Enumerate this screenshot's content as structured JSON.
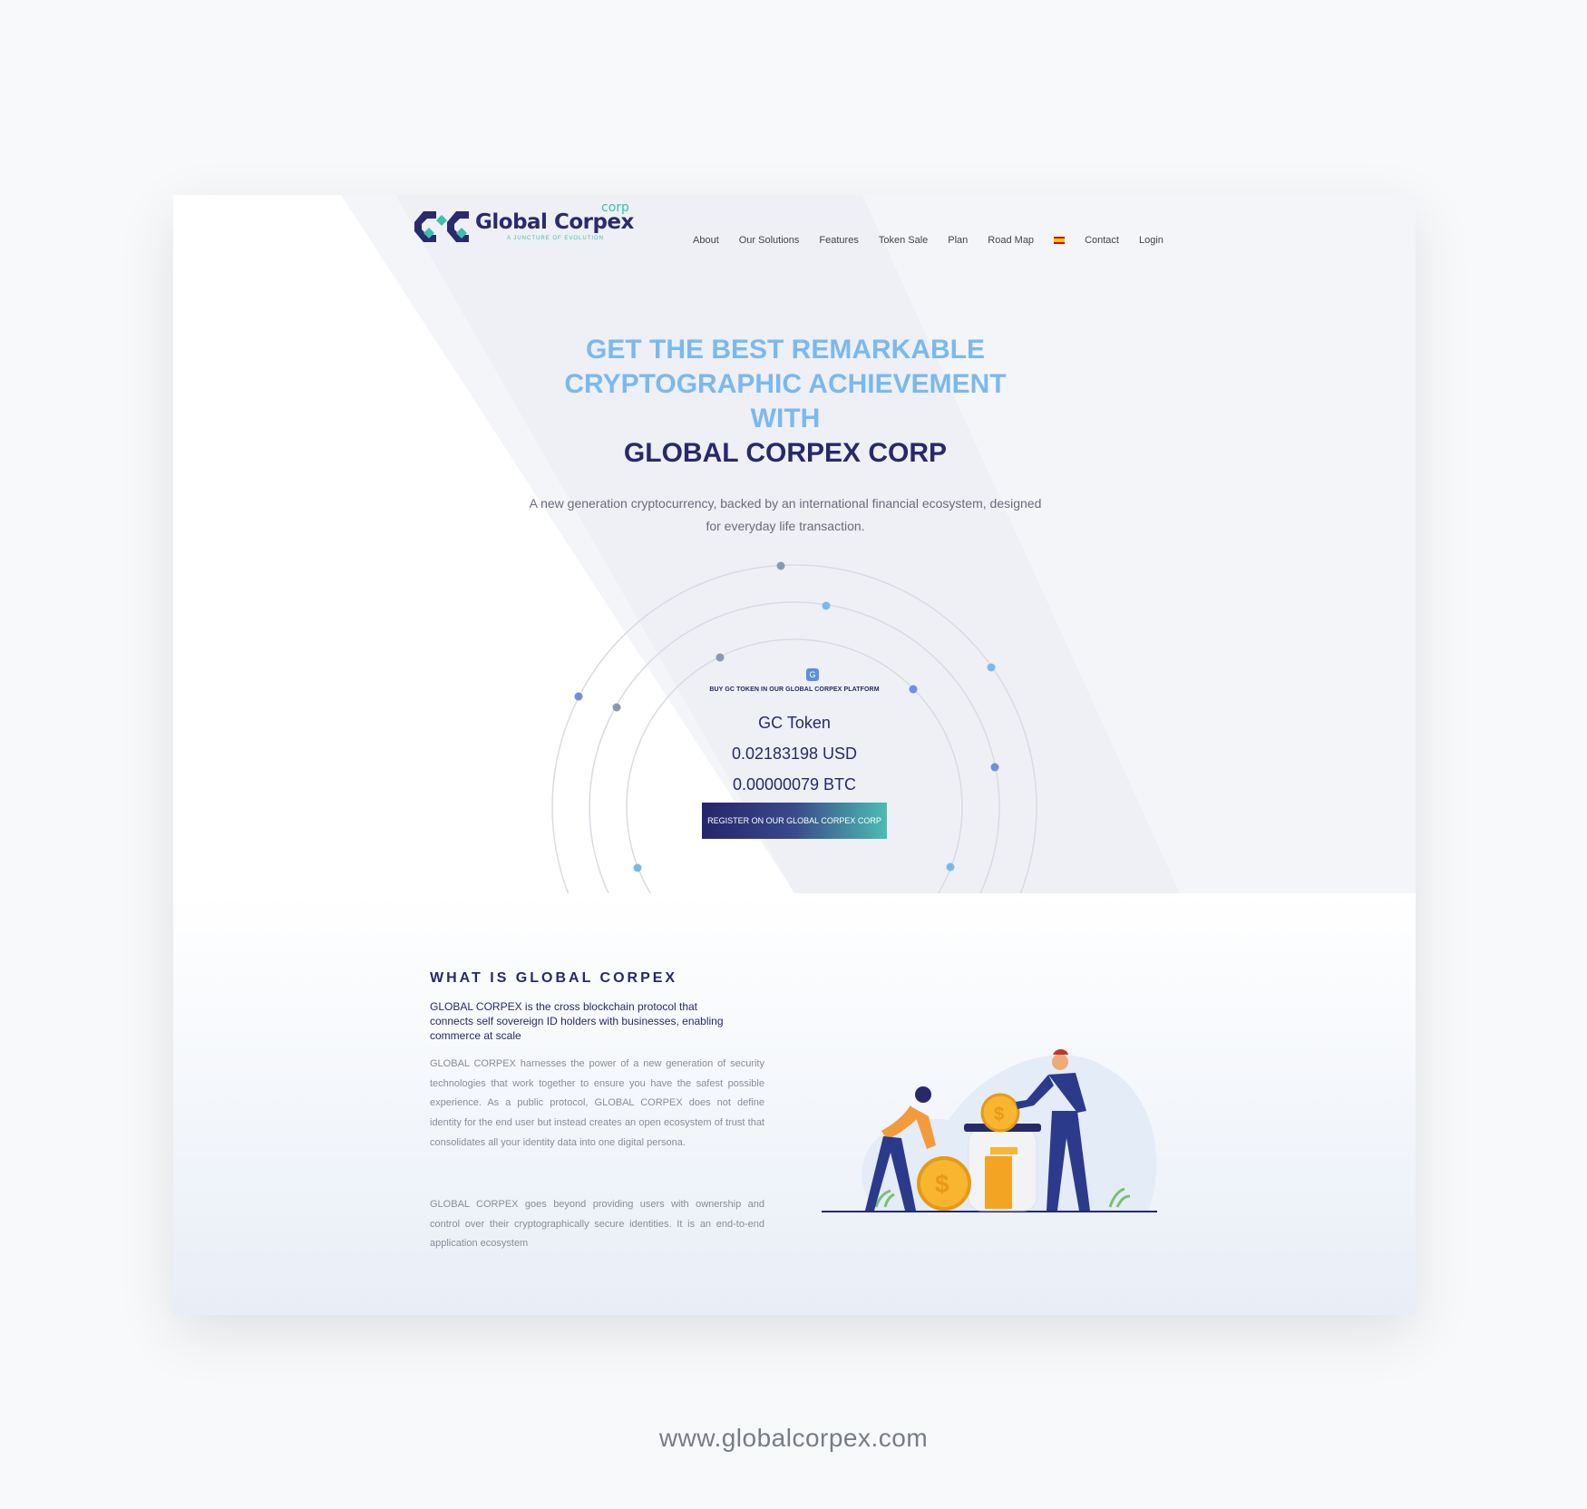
{
  "brand": {
    "name": "Global Corpex",
    "suffix": "corp",
    "tagline": "A JUNCTURE OF EVOLUTION"
  },
  "nav": {
    "items": [
      "About",
      "Our Solutions",
      "Features",
      "Token Sale",
      "Plan",
      "Road Map"
    ],
    "language": "flag-es-icon",
    "contact": "Contact",
    "login": "Login"
  },
  "hero": {
    "headline_light": [
      "GET THE BEST REMARKABLE",
      "CRYPTOGRAPHIC ACHIEVEMENT",
      "WITH"
    ],
    "headline_dark": "GLOBAL CORPEX CORP",
    "subtitle": "A new generation cryptocurrency, backed by an international financial ecosystem, designed for everyday life transaction."
  },
  "token": {
    "icon": "token-logo-icon",
    "buy_label": "BUY GC TOKEN IN OUR GLOBAL CORPEX PLATFORM",
    "name": "GC Token",
    "usd": "0.02183198 USD",
    "btc": "0.00000079 BTC",
    "register": "REGISTER ON OUR GLOBAL CORPEX CORP"
  },
  "about": {
    "title": "WHAT IS GLOBAL CORPEX",
    "lead": "GLOBAL CORPEX is the cross blockchain protocol that connects self sovereign ID holders with businesses, enabling commerce at scale",
    "p1": "GLOBAL CORPEX harnesses the power of a new generation of security technologies that work together to ensure you have the safest possible experience. As a public protocol, GLOBAL CORPEX does not define identity for the end user but instead creates an open ecosystem of trust that consolidates all your identity data into one digital persona.",
    "p2": "GLOBAL CORPEX goes beyond providing users with ownership and control over their cryptographically secure identities. It is an end-to-end application ecosystem"
  },
  "footer": {
    "website": "www.globalcorpex.com"
  },
  "colors": {
    "navy": "#27296b",
    "light_blue": "#7ab9ef",
    "teal": "#3cc0ab"
  }
}
